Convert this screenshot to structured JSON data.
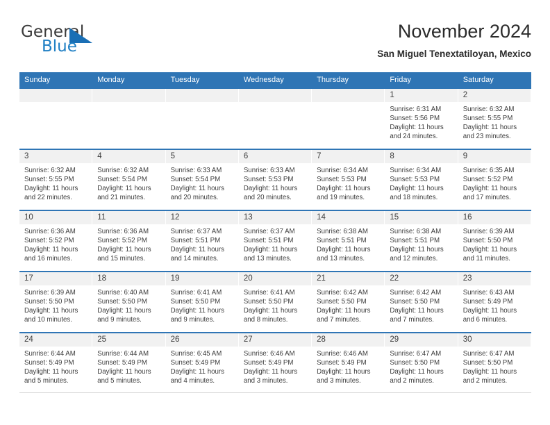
{
  "logo": {
    "word_one": "General",
    "word_two": "Blue",
    "triangle": "triangle-icon"
  },
  "header": {
    "title": "November 2024",
    "subtitle": "San Miguel Tenextatiloyan, Mexico"
  },
  "colors": {
    "header_blue": "#2f75b5",
    "logo_blue": "#1f7fc4",
    "day_strip_gray": "#f1f1f1",
    "text": "#3c3c3c"
  },
  "weekday_headers": [
    "Sunday",
    "Monday",
    "Tuesday",
    "Wednesday",
    "Thursday",
    "Friday",
    "Saturday"
  ],
  "labels": {
    "sunrise_prefix": "Sunrise:",
    "sunset_prefix": "Sunset:",
    "daylight_prefix": "Daylight:"
  },
  "weeks": [
    [
      {
        "day": "",
        "l1": "",
        "l2": "",
        "l3": "",
        "l4": ""
      },
      {
        "day": "",
        "l1": "",
        "l2": "",
        "l3": "",
        "l4": ""
      },
      {
        "day": "",
        "l1": "",
        "l2": "",
        "l3": "",
        "l4": ""
      },
      {
        "day": "",
        "l1": "",
        "l2": "",
        "l3": "",
        "l4": ""
      },
      {
        "day": "",
        "l1": "",
        "l2": "",
        "l3": "",
        "l4": ""
      },
      {
        "day": "1",
        "l1": "Sunrise: 6:31 AM",
        "l2": "Sunset: 5:56 PM",
        "l3": "Daylight: 11 hours",
        "l4": "and 24 minutes."
      },
      {
        "day": "2",
        "l1": "Sunrise: 6:32 AM",
        "l2": "Sunset: 5:55 PM",
        "l3": "Daylight: 11 hours",
        "l4": "and 23 minutes."
      }
    ],
    [
      {
        "day": "3",
        "l1": "Sunrise: 6:32 AM",
        "l2": "Sunset: 5:55 PM",
        "l3": "Daylight: 11 hours",
        "l4": "and 22 minutes."
      },
      {
        "day": "4",
        "l1": "Sunrise: 6:32 AM",
        "l2": "Sunset: 5:54 PM",
        "l3": "Daylight: 11 hours",
        "l4": "and 21 minutes."
      },
      {
        "day": "5",
        "l1": "Sunrise: 6:33 AM",
        "l2": "Sunset: 5:54 PM",
        "l3": "Daylight: 11 hours",
        "l4": "and 20 minutes."
      },
      {
        "day": "6",
        "l1": "Sunrise: 6:33 AM",
        "l2": "Sunset: 5:53 PM",
        "l3": "Daylight: 11 hours",
        "l4": "and 20 minutes."
      },
      {
        "day": "7",
        "l1": "Sunrise: 6:34 AM",
        "l2": "Sunset: 5:53 PM",
        "l3": "Daylight: 11 hours",
        "l4": "and 19 minutes."
      },
      {
        "day": "8",
        "l1": "Sunrise: 6:34 AM",
        "l2": "Sunset: 5:53 PM",
        "l3": "Daylight: 11 hours",
        "l4": "and 18 minutes."
      },
      {
        "day": "9",
        "l1": "Sunrise: 6:35 AM",
        "l2": "Sunset: 5:52 PM",
        "l3": "Daylight: 11 hours",
        "l4": "and 17 minutes."
      }
    ],
    [
      {
        "day": "10",
        "l1": "Sunrise: 6:36 AM",
        "l2": "Sunset: 5:52 PM",
        "l3": "Daylight: 11 hours",
        "l4": "and 16 minutes."
      },
      {
        "day": "11",
        "l1": "Sunrise: 6:36 AM",
        "l2": "Sunset: 5:52 PM",
        "l3": "Daylight: 11 hours",
        "l4": "and 15 minutes."
      },
      {
        "day": "12",
        "l1": "Sunrise: 6:37 AM",
        "l2": "Sunset: 5:51 PM",
        "l3": "Daylight: 11 hours",
        "l4": "and 14 minutes."
      },
      {
        "day": "13",
        "l1": "Sunrise: 6:37 AM",
        "l2": "Sunset: 5:51 PM",
        "l3": "Daylight: 11 hours",
        "l4": "and 13 minutes."
      },
      {
        "day": "14",
        "l1": "Sunrise: 6:38 AM",
        "l2": "Sunset: 5:51 PM",
        "l3": "Daylight: 11 hours",
        "l4": "and 13 minutes."
      },
      {
        "day": "15",
        "l1": "Sunrise: 6:38 AM",
        "l2": "Sunset: 5:51 PM",
        "l3": "Daylight: 11 hours",
        "l4": "and 12 minutes."
      },
      {
        "day": "16",
        "l1": "Sunrise: 6:39 AM",
        "l2": "Sunset: 5:50 PM",
        "l3": "Daylight: 11 hours",
        "l4": "and 11 minutes."
      }
    ],
    [
      {
        "day": "17",
        "l1": "Sunrise: 6:39 AM",
        "l2": "Sunset: 5:50 PM",
        "l3": "Daylight: 11 hours",
        "l4": "and 10 minutes."
      },
      {
        "day": "18",
        "l1": "Sunrise: 6:40 AM",
        "l2": "Sunset: 5:50 PM",
        "l3": "Daylight: 11 hours",
        "l4": "and 9 minutes."
      },
      {
        "day": "19",
        "l1": "Sunrise: 6:41 AM",
        "l2": "Sunset: 5:50 PM",
        "l3": "Daylight: 11 hours",
        "l4": "and 9 minutes."
      },
      {
        "day": "20",
        "l1": "Sunrise: 6:41 AM",
        "l2": "Sunset: 5:50 PM",
        "l3": "Daylight: 11 hours",
        "l4": "and 8 minutes."
      },
      {
        "day": "21",
        "l1": "Sunrise: 6:42 AM",
        "l2": "Sunset: 5:50 PM",
        "l3": "Daylight: 11 hours",
        "l4": "and 7 minutes."
      },
      {
        "day": "22",
        "l1": "Sunrise: 6:42 AM",
        "l2": "Sunset: 5:50 PM",
        "l3": "Daylight: 11 hours",
        "l4": "and 7 minutes."
      },
      {
        "day": "23",
        "l1": "Sunrise: 6:43 AM",
        "l2": "Sunset: 5:49 PM",
        "l3": "Daylight: 11 hours",
        "l4": "and 6 minutes."
      }
    ],
    [
      {
        "day": "24",
        "l1": "Sunrise: 6:44 AM",
        "l2": "Sunset: 5:49 PM",
        "l3": "Daylight: 11 hours",
        "l4": "and 5 minutes."
      },
      {
        "day": "25",
        "l1": "Sunrise: 6:44 AM",
        "l2": "Sunset: 5:49 PM",
        "l3": "Daylight: 11 hours",
        "l4": "and 5 minutes."
      },
      {
        "day": "26",
        "l1": "Sunrise: 6:45 AM",
        "l2": "Sunset: 5:49 PM",
        "l3": "Daylight: 11 hours",
        "l4": "and 4 minutes."
      },
      {
        "day": "27",
        "l1": "Sunrise: 6:46 AM",
        "l2": "Sunset: 5:49 PM",
        "l3": "Daylight: 11 hours",
        "l4": "and 3 minutes."
      },
      {
        "day": "28",
        "l1": "Sunrise: 6:46 AM",
        "l2": "Sunset: 5:49 PM",
        "l3": "Daylight: 11 hours",
        "l4": "and 3 minutes."
      },
      {
        "day": "29",
        "l1": "Sunrise: 6:47 AM",
        "l2": "Sunset: 5:50 PM",
        "l3": "Daylight: 11 hours",
        "l4": "and 2 minutes."
      },
      {
        "day": "30",
        "l1": "Sunrise: 6:47 AM",
        "l2": "Sunset: 5:50 PM",
        "l3": "Daylight: 11 hours",
        "l4": "and 2 minutes."
      }
    ]
  ]
}
